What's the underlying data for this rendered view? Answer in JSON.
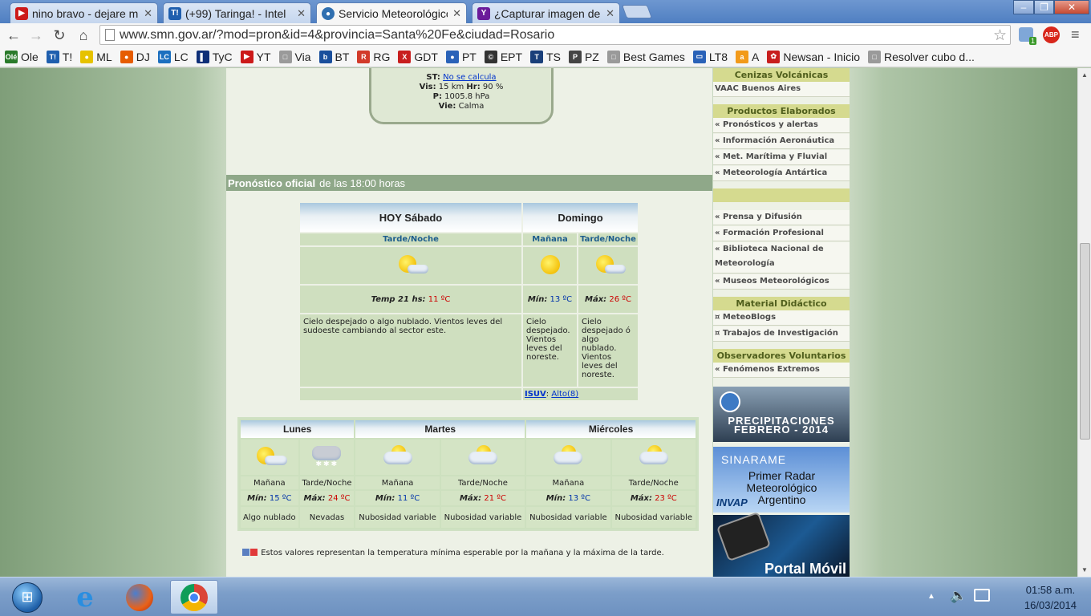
{
  "browser": {
    "tabs": [
      {
        "title": "nino bravo - dejare mi",
        "icon": "youtube-icon",
        "color": "#cc1a1a",
        "glyph": "▶"
      },
      {
        "title": "(+99) Taringa! - Intel",
        "icon": "taringa-icon",
        "color": "#1f5fae",
        "glyph": "T!"
      },
      {
        "title": "Servicio Meteorológico",
        "icon": "smn-icon",
        "color": "#2f6fb0",
        "glyph": "●"
      },
      {
        "title": "¿Capturar imagen de p",
        "icon": "yahoo-icon",
        "color": "#6b1b9a",
        "glyph": "Y"
      }
    ],
    "url": "www.smn.gov.ar/?mod=pron&id=4&provincia=Santa%20Fe&ciudad=Rosario",
    "extension_badge": "1",
    "abp_label": "ABP",
    "bookmarks": [
      {
        "label": "Ole",
        "color": "#2a7a2a",
        "glyph": "Olé"
      },
      {
        "label": "T!",
        "color": "#1f5fae",
        "glyph": "T!"
      },
      {
        "label": "ML",
        "color": "#e6c200",
        "glyph": "●"
      },
      {
        "label": "DJ",
        "color": "#e65c00",
        "glyph": "●"
      },
      {
        "label": "LC",
        "color": "#1c6fbf",
        "glyph": "LC"
      },
      {
        "label": "TyC",
        "color": "#0e2f78",
        "glyph": "▌"
      },
      {
        "label": "YT",
        "color": "#cc1a1a",
        "glyph": "▶"
      },
      {
        "label": "Via",
        "color": "#9a9a9a",
        "glyph": "□"
      },
      {
        "label": "BT",
        "color": "#1a4f9c",
        "glyph": "b"
      },
      {
        "label": "RG",
        "color": "#d23a2a",
        "glyph": "R"
      },
      {
        "label": "GDT",
        "color": "#c81e1e",
        "glyph": "X"
      },
      {
        "label": "PT",
        "color": "#2a62b8",
        "glyph": "●"
      },
      {
        "label": "EPT",
        "color": "#333333",
        "glyph": "©"
      },
      {
        "label": "TS",
        "color": "#1a3f7a",
        "glyph": "T"
      },
      {
        "label": "PZ",
        "color": "#444444",
        "glyph": "P"
      },
      {
        "label": "Best Games",
        "color": "#9a9a9a",
        "glyph": "□"
      },
      {
        "label": "LT8",
        "color": "#2a62b8",
        "glyph": "▭"
      },
      {
        "label": "A",
        "color": "#f29a1a",
        "glyph": "a"
      },
      {
        "label": "Newsan - Inicio",
        "color": "#c81e1e",
        "glyph": "✿"
      },
      {
        "label": "Resolver cubo d...",
        "color": "#9a9a9a",
        "glyph": "□"
      }
    ]
  },
  "current": {
    "st_label": "ST:",
    "st_value": "No se calcula",
    "vis_label": "Vis:",
    "vis_value": "15 km",
    "hr_label": "Hr:",
    "hr_value": "90 %",
    "p_label": "P:",
    "p_value": "1005.8 hPa",
    "vie_label": "Vie:",
    "vie_value": "Calma"
  },
  "pronostico": {
    "title": "Pronóstico oficial",
    "subtitle": "de las 18:00 horas",
    "today_header": "HOY Sábado",
    "tomorrow_header": "Domingo",
    "today_period": "Tarde/Noche",
    "tom_morning": "Mañana",
    "tom_evening": "Tarde/Noche",
    "today_temp_label": "Temp 21 hs:",
    "today_temp": "11 ºC",
    "tom_min_label": "Mín:",
    "tom_min": "13 ºC",
    "tom_max_label": "Máx:",
    "tom_max": "26 ºC",
    "today_desc": "Cielo despejado o algo nublado. Vientos leves del sudoeste cambiando al sector este.",
    "tom_morning_desc": "Cielo despejado. Vientos leves del noreste.",
    "tom_evening_desc": "Cielo despejado ó algo nublado. Vientos leves del noreste.",
    "isuv_label": "ISUV",
    "isuv_value": "Alto(8)"
  },
  "extended": {
    "days": [
      {
        "name": "Lunes",
        "morning": "Mañana",
        "evening": "Tarde/Noche",
        "min_label": "Mín:",
        "min": "15 ºC",
        "max_label": "Máx:",
        "max": "24 ºC",
        "desc_m": "Algo nublado",
        "desc_e": "Nevadas"
      },
      {
        "name": "Martes",
        "morning": "Mañana",
        "evening": "Tarde/Noche",
        "min_label": "Mín:",
        "min": "11 ºC",
        "max_label": "Máx:",
        "max": "21 ºC",
        "desc_m": "Nubosidad variable",
        "desc_e": "Nubosidad variable"
      },
      {
        "name": "Miércoles",
        "morning": "Mañana",
        "evening": "Tarde/Noche",
        "min_label": "Mín:",
        "min": "13 ºC",
        "max_label": "Máx:",
        "max": "23 ºC",
        "desc_m": "Nubosidad variable",
        "desc_e": "Nubosidad variable"
      }
    ],
    "note": "Estos valores representan la temperatura mínima esperable por la mañana y la máxima de la tarde."
  },
  "sidebar": {
    "ceniza_header": "Cenizas Volcánicas",
    "ceniza_item": "VAAC Buenos Aires",
    "productos_header": "Productos Elaborados",
    "productos_items": [
      "« Pronósticos y alertas",
      "« Información Aeronáutica",
      "« Met. Marítima y Fluvial",
      "« Meteorología Antártica"
    ],
    "inst_items": [
      "« Prensa y Difusión",
      "« Formación Profesional"
    ],
    "biblioteca": "« Biblioteca Nacional de Meteorología",
    "museos": "« Museos Meteorológicos",
    "material_header": "Material Didáctico",
    "material_items": [
      "¤ MeteoBlogs",
      "¤ Trabajos de Investigación"
    ],
    "obs_header": "Observadores Voluntarios",
    "obs_item": "« Fenómenos Extremos",
    "banner1": "PRECIPITACIONES FEBRERO - 2014",
    "banner2_top": "SINARAME",
    "banner2_main": "Primer Radar Meteorológico Argentino",
    "banner2_brand": "INVAP",
    "banner3": "Portal Móvil"
  },
  "taskbar": {
    "time": "01:58 a.m.",
    "date": "16/03/2014"
  }
}
